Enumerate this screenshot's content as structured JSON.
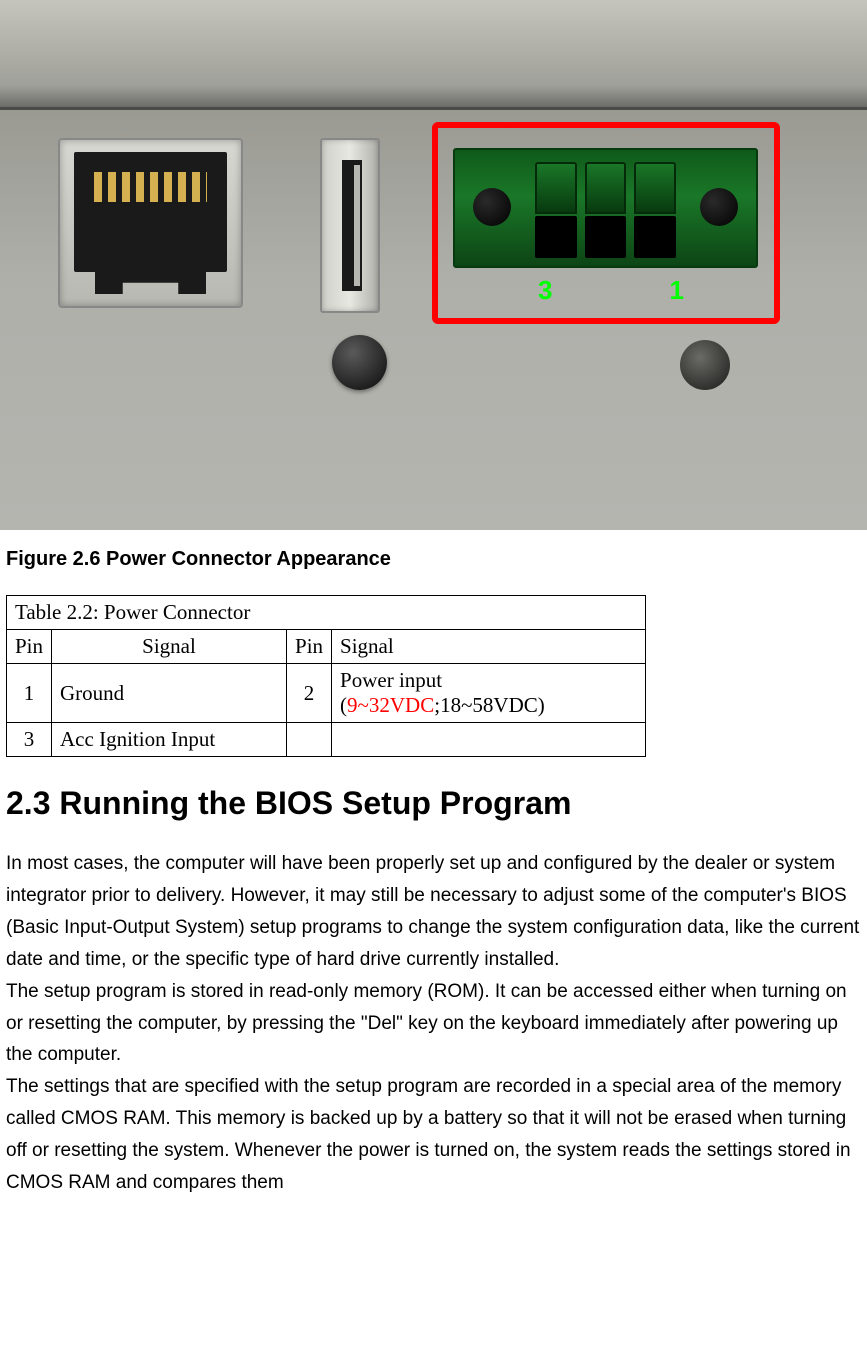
{
  "figure": {
    "caption": "Figure 2.6 Power Connector Appearance",
    "pin_labels": {
      "left": "3",
      "right": "1"
    }
  },
  "table": {
    "title": "Table 2.2: Power Connector",
    "headers": {
      "pin_a": "Pin",
      "signal_a": "Signal",
      "pin_b": "Pin",
      "signal_b": "Signal"
    },
    "rows": [
      {
        "pin_a": "1",
        "signal_a": "Ground",
        "pin_b": "2",
        "signal_b_line1": "Power input",
        "signal_b_line2_open": "(",
        "signal_b_line2_red": "9~32VDC",
        "signal_b_line2_rest": ";18~58VDC)"
      },
      {
        "pin_a": "3",
        "signal_a": "Acc Ignition Input",
        "pin_b": "",
        "signal_b": ""
      }
    ]
  },
  "section": {
    "heading": "2.3 Running the BIOS Setup Program",
    "paragraph": "In most cases, the computer will have been properly set up and configured by the dealer or system integrator prior to delivery. However, it may still be necessary to adjust some of the computer's BIOS (Basic Input-Output System) setup programs to change the system configuration data, like the current date and time, or the specific type of hard drive currently installed.\nThe setup program is stored in read-only memory (ROM). It can be accessed either when turning on or resetting the computer, by pressing the \"Del\" key on the keyboard immediately after powering up the computer.\nThe settings that are specified with the setup program are recorded in a special area of the memory called CMOS RAM. This memory is backed up by a battery so that it will not be erased when turning off or resetting the system. Whenever the power is turned on, the system reads the settings stored in CMOS RAM and compares them"
  }
}
